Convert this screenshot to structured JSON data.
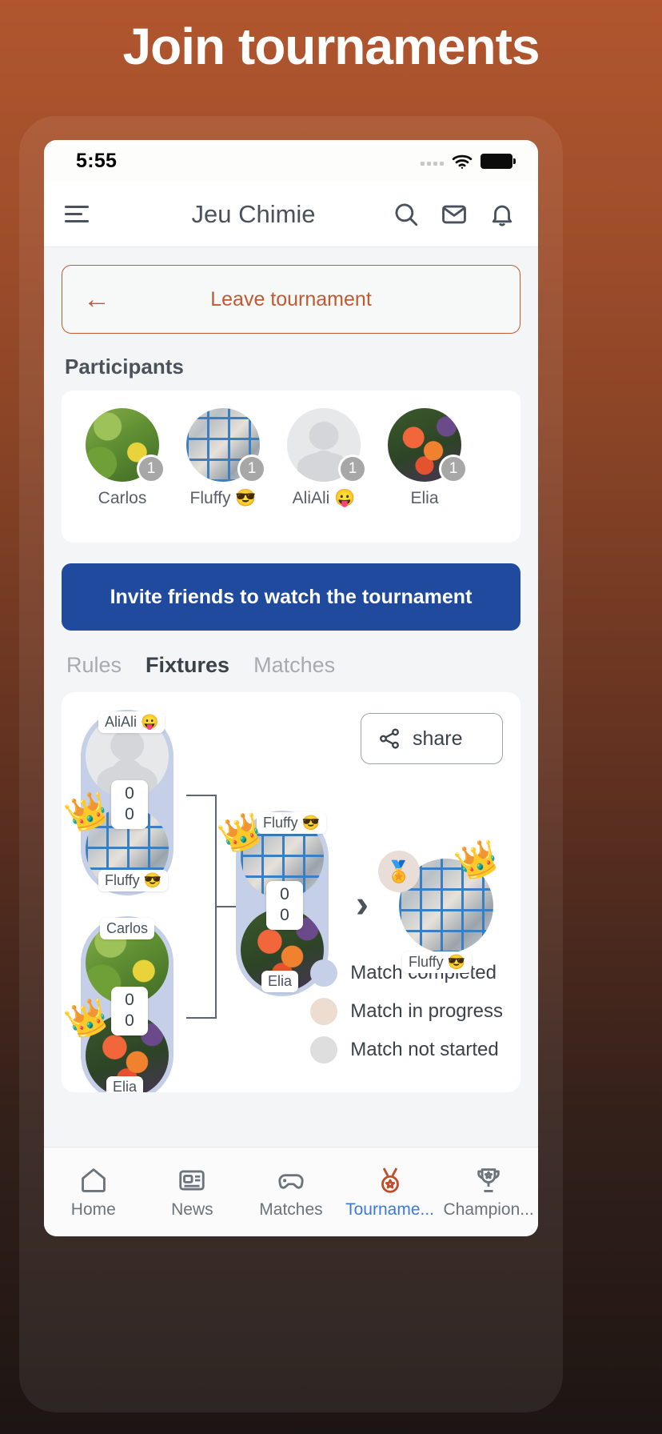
{
  "promo": {
    "headline": "Join tournaments"
  },
  "status_bar": {
    "time": "5:55",
    "signal_icon": "signal-dots-icon",
    "wifi_icon": "wifi-icon",
    "battery_icon": "battery-full-icon"
  },
  "app_bar": {
    "menu_icon": "hamburger-menu-icon",
    "title": "Jeu Chimie",
    "search_icon": "search-icon",
    "mail_icon": "mail-icon",
    "bell_icon": "bell-icon"
  },
  "leave_tournament": {
    "label": "Leave tournament",
    "back_icon": "arrow-left-icon"
  },
  "participants": {
    "section_title": "Participants",
    "items": [
      {
        "name": "Carlos",
        "badge": "1",
        "avatar": "leaf-photo"
      },
      {
        "name": "Fluffy 😎",
        "badge": "1",
        "avatar": "collage-photo"
      },
      {
        "name": "AliAli 😛",
        "badge": "1",
        "avatar": "default-person-avatar"
      },
      {
        "name": "Elia",
        "badge": "1",
        "avatar": "flower-photo"
      }
    ]
  },
  "invite": {
    "label": "Invite friends to watch the tournament"
  },
  "tabs": [
    {
      "label": "Rules",
      "active": false
    },
    {
      "label": "Fixtures",
      "active": true
    },
    {
      "label": "Matches",
      "active": false
    }
  ],
  "bracket": {
    "share": {
      "label": "share",
      "icon": "share-nodes-icon"
    },
    "semifinal_1": {
      "top": {
        "name": "AliAli 😛",
        "score": "0",
        "avatar": "default-person-avatar",
        "winner": false
      },
      "bottom": {
        "name": "Fluffy 😎",
        "score": "0",
        "avatar": "collage-photo",
        "winner": true
      }
    },
    "semifinal_2": {
      "top": {
        "name": "Carlos",
        "score": "0",
        "avatar": "leaf-photo",
        "winner": false
      },
      "bottom": {
        "name": "Elia",
        "score": "0",
        "avatar": "flower-photo",
        "winner": true
      }
    },
    "final": {
      "top": {
        "name": "Fluffy 😎",
        "score": "0",
        "avatar": "collage-photo",
        "winner": true
      },
      "bottom": {
        "name": "Elia",
        "score": "0",
        "avatar": "flower-photo",
        "winner": false
      }
    },
    "champion": {
      "name": "Fluffy 😎",
      "avatar": "collage-photo",
      "medal_icon": "medal-icon",
      "crown_icon": "crown-icon",
      "chevron_icon": "chevron-right-icon"
    },
    "legend": [
      {
        "label": "Match completed",
        "color": "#c5cfe8"
      },
      {
        "label": "Match in progress",
        "color": "#eddcd0"
      },
      {
        "label": "Match not started",
        "color": "#dedede"
      }
    ]
  },
  "bottom_nav": [
    {
      "label": "Home",
      "icon": "home-icon",
      "active": false
    },
    {
      "label": "News",
      "icon": "news-icon",
      "active": false
    },
    {
      "label": "Matches",
      "icon": "gamepad-icon",
      "active": false
    },
    {
      "label": "Tourname...",
      "icon": "medal-icon",
      "active": true
    },
    {
      "label": "Champion...",
      "icon": "trophy-icon",
      "active": false
    }
  ],
  "colors": {
    "brand_orange": "#c0502c",
    "invite_blue": "#1f4a9e",
    "active_tab_blue": "#3b7ad9"
  }
}
